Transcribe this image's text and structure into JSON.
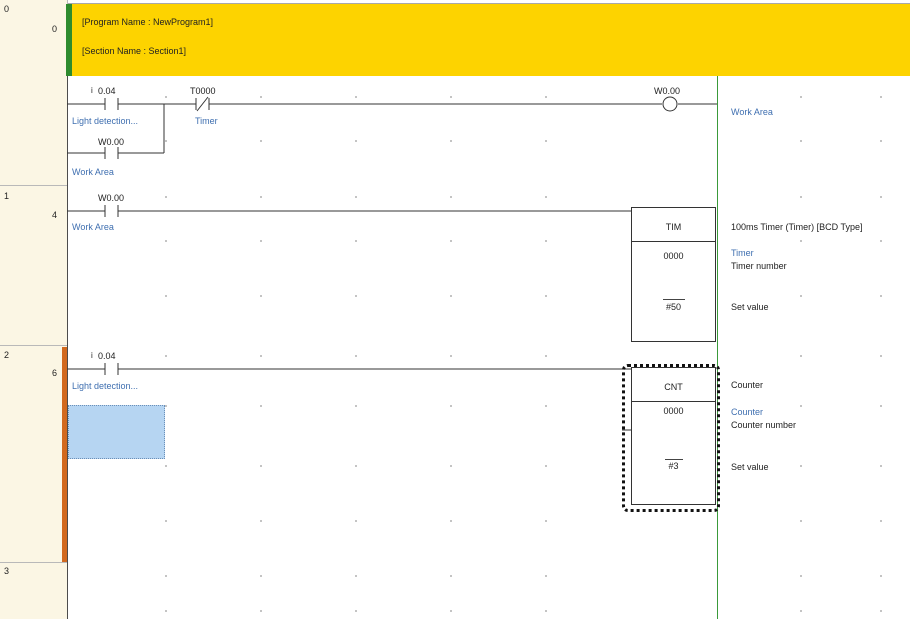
{
  "header": {
    "program_name": "[Program Name : NewProgram1]",
    "section_name": "[Section Name : Section1]"
  },
  "rungs": [
    {
      "rung": "0",
      "step": "0"
    },
    {
      "rung": "1",
      "step": "4"
    },
    {
      "rung": "2",
      "step": "6"
    },
    {
      "rung": "3",
      "step": ""
    }
  ],
  "rung0": {
    "contact1": {
      "operand": "0.04",
      "comment": "Light detection..."
    },
    "contact2": {
      "operand": "T0000",
      "comment": "Timer"
    },
    "contact3": {
      "operand": "W0.00",
      "comment": "Work Area"
    },
    "coil": {
      "operand": "W0.00",
      "comment": "Work Area"
    }
  },
  "rung1": {
    "contact": {
      "operand": "W0.00",
      "comment": "Work Area"
    },
    "instruction": {
      "mnemonic": "TIM",
      "operand1": "0000",
      "operand2": "#50"
    },
    "right": {
      "desc": "100ms Timer (Timer) [BCD Type]",
      "op1_comment": "Timer",
      "op1_label": "Timer number",
      "op2_label": "Set value"
    }
  },
  "rung2": {
    "contact": {
      "operand": "0.04",
      "comment": "Light detection..."
    },
    "instruction": {
      "mnemonic": "CNT",
      "operand1": "0000",
      "operand2": "#3"
    },
    "right": {
      "desc": "Counter",
      "op1_comment": "Counter",
      "op1_label": "Counter number",
      "op2_label": "Set value"
    }
  },
  "colors": {
    "header_bg": "#fdd300",
    "header_marker": "#2e8b2e",
    "comment_text": "#3f6fb0",
    "right_rail": "#3a9a3a",
    "rung2_marker": "#d2691e",
    "selection": "#b6d5f2"
  }
}
